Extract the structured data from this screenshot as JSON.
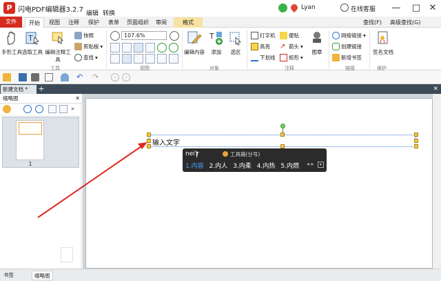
{
  "app": {
    "logo": "P",
    "title": "闪电PDF编辑器3.2.7",
    "menus": [
      "编辑",
      "转换"
    ],
    "user_name": "Lyan",
    "service_label": "在线客服",
    "controls": {
      "minimize": "—",
      "maximize": "□",
      "close": "✕"
    }
  },
  "tabs": {
    "file": "文件",
    "start": "开始",
    "view": "视图",
    "annotate": "注释",
    "protect": "保护",
    "form": "表单",
    "page_organize": "页面组织",
    "review": "审阅",
    "format": "格式",
    "find": "查找(F)",
    "advanced_find": "高级查找(G)"
  },
  "ribbon": {
    "tools": {
      "hand": "手形工具",
      "select": "选取工具",
      "edit_annot": "编辑注释工具",
      "snapshot": "快照",
      "clipboard": "剪贴板",
      "find": "查找",
      "label": "工具"
    },
    "view": {
      "zoom": "107.6%",
      "label": "视图"
    },
    "objects": {
      "edit_content": "编辑内容",
      "add": "添加",
      "select_area": "选区",
      "label": "对象"
    },
    "annotations": {
      "typewriter": "打字机",
      "highlight": "高亮",
      "underline": "下划线",
      "sticky": "便贴",
      "arrow": "箭头",
      "rectangle": "矩形",
      "stamp": "图章",
      "label": "注释"
    },
    "links": {
      "web_link": "网络链接",
      "create_link": "创建链接",
      "new_bookmark": "新增书签",
      "label": "链接"
    },
    "protect": {
      "sign": "签名文档",
      "label": "保护"
    }
  },
  "doc_tab": {
    "name": "新建文档 *",
    "add": "+",
    "close": "✕"
  },
  "sidebar": {
    "title": "缩略图",
    "close": "✕",
    "page_number": "1",
    "bottom_tabs": [
      "书签",
      "缩略图"
    ]
  },
  "editor": {
    "text": "输入文字"
  },
  "ime": {
    "pinyin": "nei'r",
    "name": "工具箱(分号)",
    "candidates": [
      "1.内容",
      "2.内人",
      "3.内柔",
      "4.内热",
      "5.内燃"
    ],
    "nav": "◂ ▸",
    "menu": "▾"
  },
  "colors": {
    "brand_red": "#d62a1e",
    "format_tab": "#f6e2a2",
    "doc_tabbar": "#3d4a57",
    "arrow_red": "#e0271f"
  }
}
